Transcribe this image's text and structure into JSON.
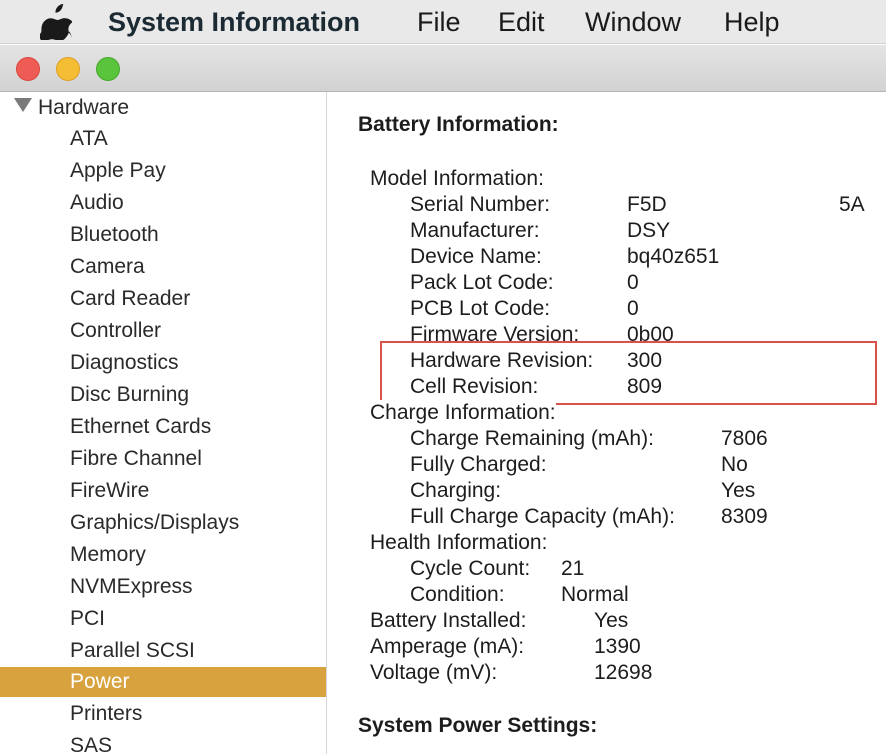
{
  "menubar": {
    "app_name": "System Information",
    "items": [
      "File",
      "Edit",
      "Window",
      "Help"
    ],
    "apple_icon": "apple-logo-icon"
  },
  "window": {
    "traffic_lights": [
      "close",
      "minimize",
      "maximize"
    ],
    "traffic_colors": {
      "close": "#ee5c55",
      "minimize": "#f5bd33",
      "maximize": "#5ac43c"
    }
  },
  "sidebar": {
    "group_label": "Hardware",
    "items": [
      "ATA",
      "Apple Pay",
      "Audio",
      "Bluetooth",
      "Camera",
      "Card Reader",
      "Controller",
      "Diagnostics",
      "Disc Burning",
      "Ethernet Cards",
      "Fibre Channel",
      "FireWire",
      "Graphics/Displays",
      "Memory",
      "NVMExpress",
      "PCI",
      "Parallel SCSI",
      "Power",
      "Printers",
      "SAS"
    ],
    "selected": "Power",
    "selected_color": "#d8a23e"
  },
  "content": {
    "section_title": "Battery Information:",
    "model_info_label": "Model Information:",
    "model_info": [
      {
        "label": "Serial Number:",
        "value": "F5D",
        "value_tail": "5A"
      },
      {
        "label": "Manufacturer:",
        "value": "DSY"
      },
      {
        "label": "Device Name:",
        "value": "bq40z651"
      },
      {
        "label": "Pack Lot Code:",
        "value": "0"
      },
      {
        "label": "PCB Lot Code:",
        "value": "0"
      },
      {
        "label": "Firmware Version:",
        "value": "0b00"
      },
      {
        "label": "Hardware Revision:",
        "value": "300"
      },
      {
        "label": "Cell Revision:",
        "value": "809"
      }
    ],
    "charge_info_label": "Charge Information:",
    "charge_info": [
      {
        "label": "Charge Remaining (mAh):",
        "value": "7806"
      },
      {
        "label": "Fully Charged:",
        "value": "No"
      },
      {
        "label": "Charging:",
        "value": "Yes"
      },
      {
        "label": "Full Charge Capacity (mAh):",
        "value": "8309"
      }
    ],
    "health_info_label": "Health Information:",
    "health_info": [
      {
        "label": "Cycle Count:",
        "value": "21"
      },
      {
        "label": "Condition:",
        "value": "Normal"
      }
    ],
    "battery_info": [
      {
        "label": "Battery Installed:",
        "value": "Yes"
      },
      {
        "label": "Amperage (mA):",
        "value": "1390"
      },
      {
        "label": "Voltage (mV):",
        "value": "12698"
      }
    ],
    "next_section_title": "System Power Settings:",
    "highlight_color": "#d9534a"
  }
}
